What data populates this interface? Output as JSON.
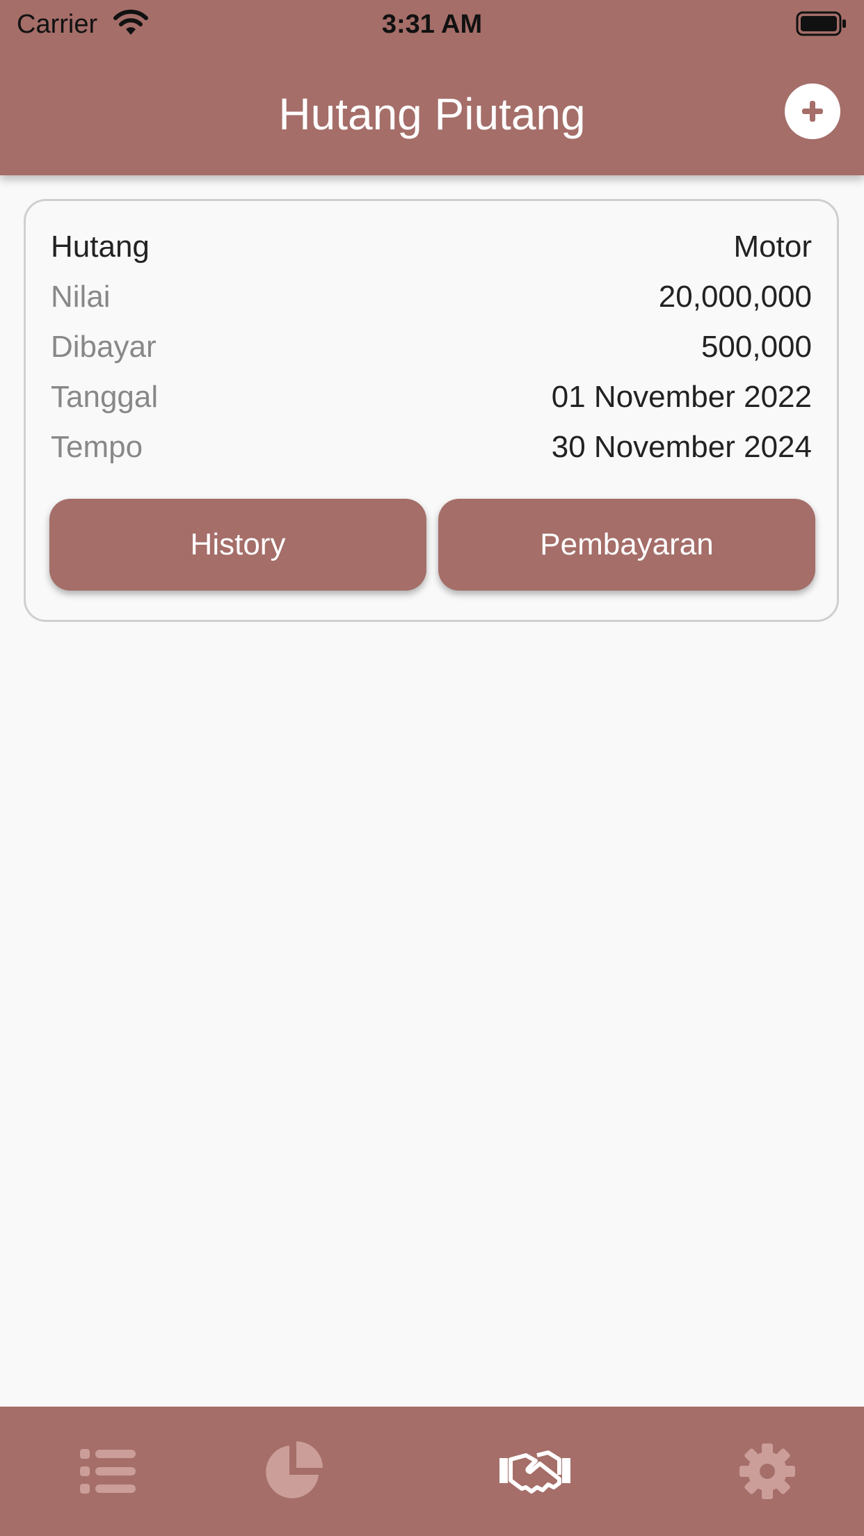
{
  "status_bar": {
    "carrier": "Carrier",
    "time": "3:31 AM"
  },
  "header": {
    "title": "Hutang Piutang",
    "add_icon": "plus-circle-icon"
  },
  "card": {
    "type_label": "Hutang",
    "type_value": "Motor",
    "rows": [
      {
        "label": "Nilai",
        "value": "20,000,000"
      },
      {
        "label": "Dibayar",
        "value": "500,000"
      },
      {
        "label": "Tanggal",
        "value": "01 November 2022"
      },
      {
        "label": "Tempo",
        "value": "30 November 2024"
      }
    ],
    "history_button": "History",
    "payment_button": "Pembayaran"
  },
  "bottom_nav": {
    "items": [
      {
        "icon": "list-icon",
        "active": false
      },
      {
        "icon": "pie-chart-icon",
        "active": false
      },
      {
        "icon": "handshake-icon",
        "active": true
      },
      {
        "icon": "gear-icon",
        "active": false
      }
    ]
  },
  "colors": {
    "primary": "#a56e69",
    "background": "#f9f9f9",
    "inactive_icon": "#cc9e99",
    "active_icon": "#ffffff"
  }
}
